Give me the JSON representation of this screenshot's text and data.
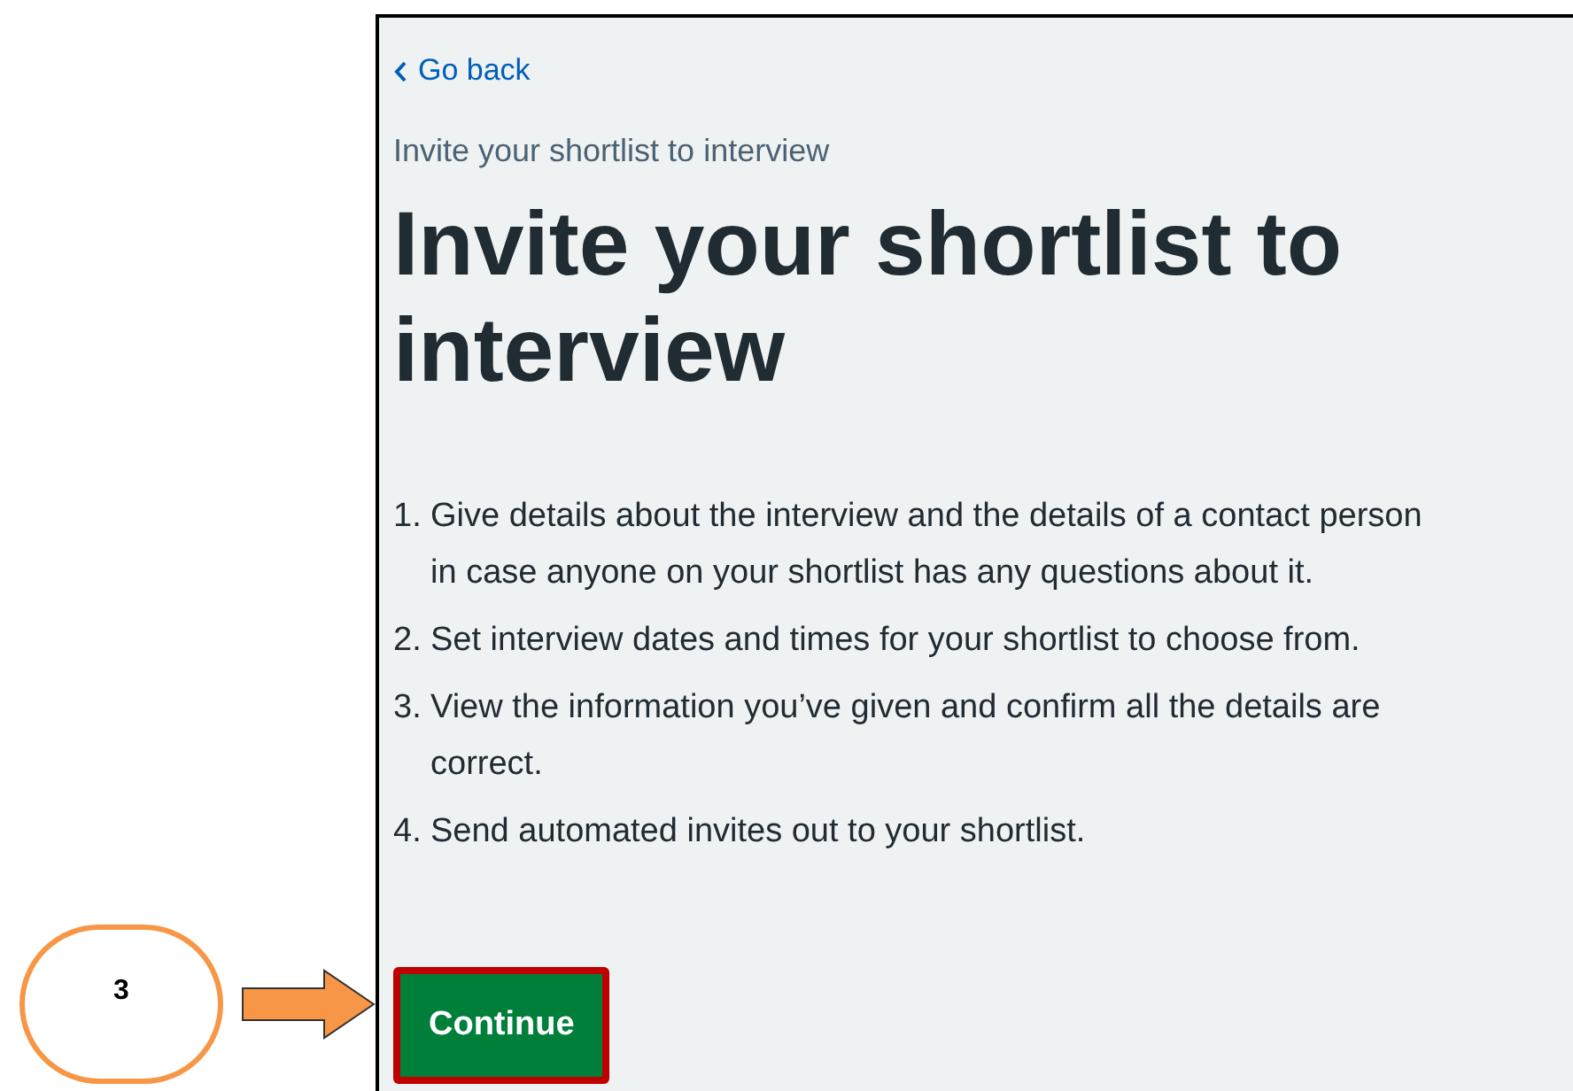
{
  "back_link": {
    "label": "Go back"
  },
  "caption": "Invite your shortlist to interview",
  "heading": "Invite your shortlist to interview",
  "steps": [
    {
      "number": "1.",
      "text": "Give details about the interview and the details of a contact person in case anyone on your shortlist has any questions about it."
    },
    {
      "number": "2.",
      "text": "Set interview dates and times for your shortlist to choose from."
    },
    {
      "number": "3.",
      "text": "View the information you’ve given and confirm all the details are correct."
    },
    {
      "number": "4.",
      "text": "Send automated invites out to your shortlist."
    }
  ],
  "continue_button": {
    "label": "Continue",
    "highlighted": true
  },
  "callout": {
    "label": "3"
  }
}
